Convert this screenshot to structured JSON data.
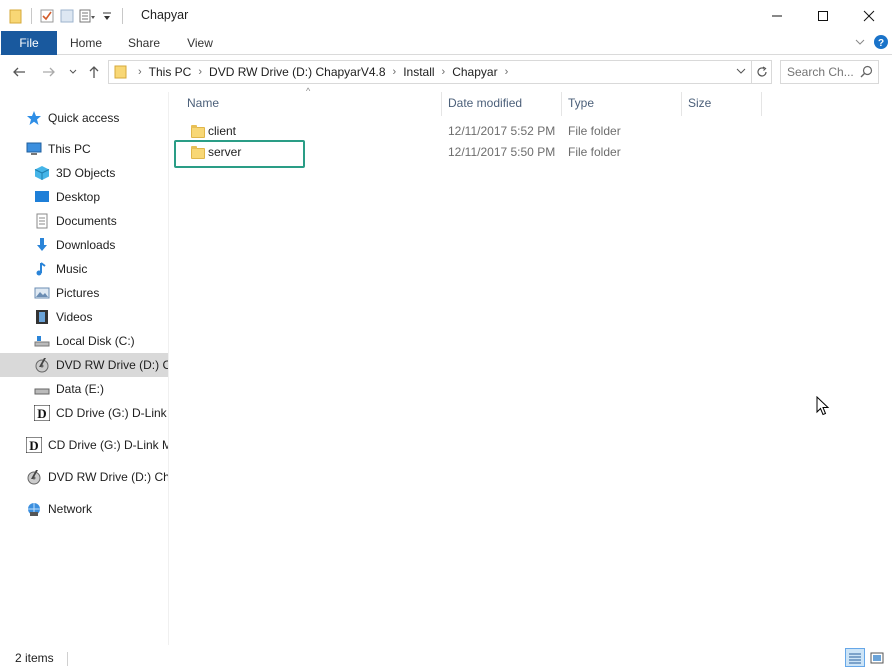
{
  "window": {
    "title": "Chapyar",
    "minimize_glyph": "—",
    "maximize_glyph": "☐",
    "close_glyph": "✕"
  },
  "ribbon": {
    "tabs": [
      {
        "label": "File"
      },
      {
        "label": "Home"
      },
      {
        "label": "Share"
      },
      {
        "label": "View"
      }
    ],
    "expand_glyph": "⌄",
    "help_glyph": "?"
  },
  "address": {
    "back_glyph": "←",
    "forward_glyph": "→",
    "recent_glyph": "⌄",
    "up_glyph": "↑",
    "crumbs": [
      "This PC",
      "DVD RW Drive (D:) ChapyarV4.8",
      "Install",
      "Chapyar"
    ],
    "chevron_glyph": "›",
    "dropdown_glyph": "⌄",
    "refresh_glyph": "↻"
  },
  "search": {
    "placeholder": "Search Ch..."
  },
  "navigation": {
    "items": [
      {
        "label": "Quick access",
        "icon": "star-icon"
      },
      {
        "label": "This PC",
        "icon": "computer-icon"
      },
      {
        "label": "3D Objects",
        "icon": "cube-icon"
      },
      {
        "label": "Desktop",
        "icon": "desktop-icon"
      },
      {
        "label": "Documents",
        "icon": "document-icon"
      },
      {
        "label": "Downloads",
        "icon": "download-icon"
      },
      {
        "label": "Music",
        "icon": "music-icon"
      },
      {
        "label": "Pictures",
        "icon": "pictures-icon"
      },
      {
        "label": "Videos",
        "icon": "film-icon"
      },
      {
        "label": "Local Disk (C:)",
        "icon": "drive-icon"
      },
      {
        "label": "DVD RW Drive (D:) Ch",
        "icon": "dvd-icon"
      },
      {
        "label": "Data (E:)",
        "icon": "drive-icon"
      },
      {
        "label": "CD Drive (G:) D-Link I",
        "icon": "dlink-icon"
      },
      {
        "label": "CD Drive (G:) D-Link M",
        "icon": "dlink-icon"
      },
      {
        "label": "DVD RW Drive (D:) Cha",
        "icon": "dvd-icon"
      },
      {
        "label": "Network",
        "icon": "network-icon"
      }
    ]
  },
  "columns": {
    "name": "Name",
    "date": "Date modified",
    "type": "Type",
    "size": "Size",
    "sort_glyph": "^"
  },
  "files": [
    {
      "name": "client",
      "date": "12/11/2017 5:52 PM",
      "type": "File folder"
    },
    {
      "name": "server",
      "date": "12/11/2017 5:50 PM",
      "type": "File folder"
    }
  ],
  "status": {
    "count": "2 items"
  },
  "colors": {
    "file_tab": "#19599e",
    "folder": "#f8d775",
    "highlight_box": "#2a9d86",
    "selected_nav": "#d9d9d9"
  }
}
